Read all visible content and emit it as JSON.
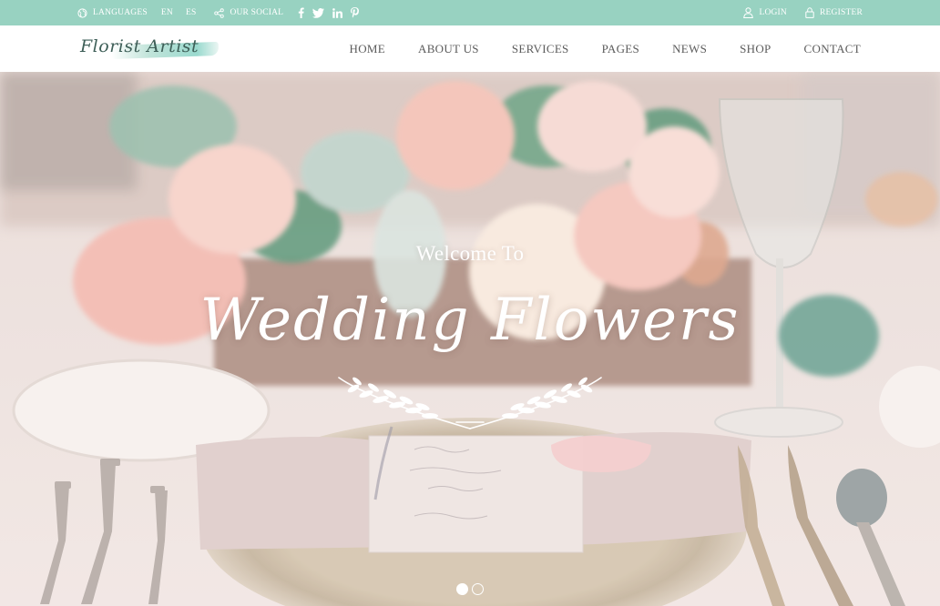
{
  "topbar": {
    "languages_label": "LANGUAGES",
    "lang_codes": [
      "EN",
      "ES"
    ],
    "social_label": "OUR SOCIAL",
    "social_icons": [
      "facebook-icon",
      "twitter-icon",
      "linkedin-icon",
      "pinterest-icon"
    ],
    "login_label": "LOGIN",
    "register_label": "REGISTER"
  },
  "brand": {
    "logo_text": "Florist Artist"
  },
  "nav": {
    "items": [
      "HOME",
      "ABOUT US",
      "SERVICES",
      "PAGES",
      "NEWS",
      "SHOP",
      "CONTACT"
    ]
  },
  "hero": {
    "welcome": "Welcome To",
    "title": "Wedding Flowers",
    "slide_count": 2,
    "active_slide": 1
  },
  "colors": {
    "accent": "#98d2c1",
    "nav_text": "#5b5b5b",
    "hero_text": "#ffffff"
  }
}
